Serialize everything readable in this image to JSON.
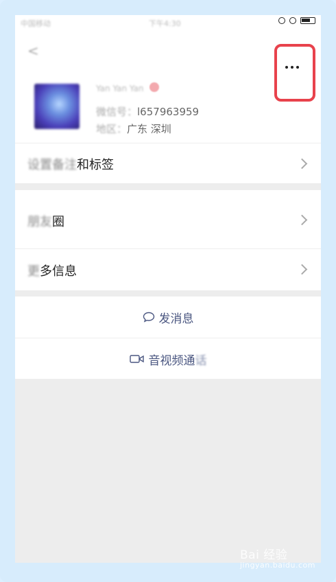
{
  "status_bar": {
    "carrier": "中国移动",
    "time": "下午4:30"
  },
  "header": {
    "nickname": "Yan Yan Yan",
    "wechat_id_label": "微信号：",
    "wechat_id": "l657963959",
    "region_label": "地区：",
    "region": "广东 深圳"
  },
  "menu": {
    "remark_blur": "设置备注",
    "remark_clear": "和标签",
    "moments_blur": "朋友",
    "moments_clear": "圈",
    "more_blur": "更",
    "more_clear": "多信息"
  },
  "actions": {
    "message": "发消息",
    "call_main": "音视频通",
    "call_tail": "话"
  },
  "watermark": {
    "brand": "Bai 经验",
    "url": "jingyan.baidu.com"
  },
  "colors": {
    "highlight": "#e8424c",
    "action_text": "#4a5680",
    "frame": "#d7ecfc"
  }
}
